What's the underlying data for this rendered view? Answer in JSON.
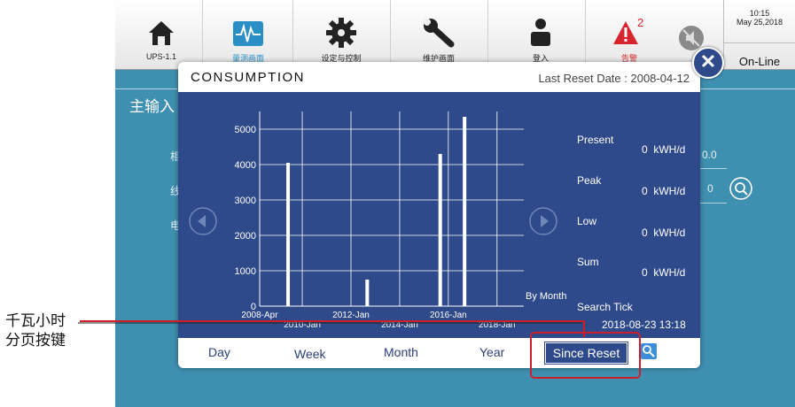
{
  "topbar": {
    "items": [
      {
        "label": "UPS-1.1",
        "icon": "home-icon"
      },
      {
        "label": "量测画面",
        "icon": "waveform-icon"
      },
      {
        "label": "设定与控制",
        "icon": "gear-icon"
      },
      {
        "label": "维护画面",
        "icon": "wrench-icon"
      },
      {
        "label": "登入",
        "icon": "user-icon"
      },
      {
        "label": "告警",
        "icon": "alarm-icon"
      }
    ],
    "alarm_count": "2",
    "clock_time": "10:15",
    "clock_date": "May 25,2018",
    "status": "On-Line"
  },
  "background": {
    "section_title": "主输入",
    "row1_label": "相",
    "row2_label": "线",
    "row3_label": "电",
    "row1_value": "0.0",
    "row2_value": "0"
  },
  "popup": {
    "title": "CONSUMPTION",
    "last_reset": "Last Reset Date : 2008-04-12",
    "by_month": "By Month",
    "stats": [
      {
        "label": "Present",
        "value": "0",
        "unit": "kWH/d"
      },
      {
        "label": "Peak",
        "value": "0",
        "unit": "kWH/d"
      },
      {
        "label": "Low",
        "value": "0",
        "unit": "kWH/d"
      },
      {
        "label": "Sum",
        "value": "0",
        "unit": "kWH/d"
      }
    ],
    "search_tick_label": "Search Tick",
    "search_tick_value": "2018-08-23 13:18",
    "tabs": [
      "Day",
      "Week",
      "Month",
      "Year"
    ],
    "active_tab": "Since Reset"
  },
  "annotation": {
    "line1": "千瓦小时",
    "line2": "分页按键"
  },
  "colors": {
    "panel_blue": "#2f4a8a",
    "screen_bg": "#3f8fb0",
    "alarm_red": "#d8262f",
    "highlight_red": "#cc1f2a"
  },
  "chart_data": {
    "type": "bar",
    "x_ticks_upper": [
      "2008-Apr",
      "2012-Jan",
      "2016-Jan"
    ],
    "x_ticks_lower": [
      "2010-Jan",
      "2014-Jan",
      "2018-Jan"
    ],
    "y_ticks": [
      0,
      1000,
      2000,
      3000,
      4000,
      5000
    ],
    "ylim": [
      0,
      5500
    ],
    "x": [
      "2009-Jun",
      "2012-Sep",
      "2015-Sep",
      "2016-Sep"
    ],
    "values": [
      4050,
      750,
      4300,
      5350
    ]
  }
}
